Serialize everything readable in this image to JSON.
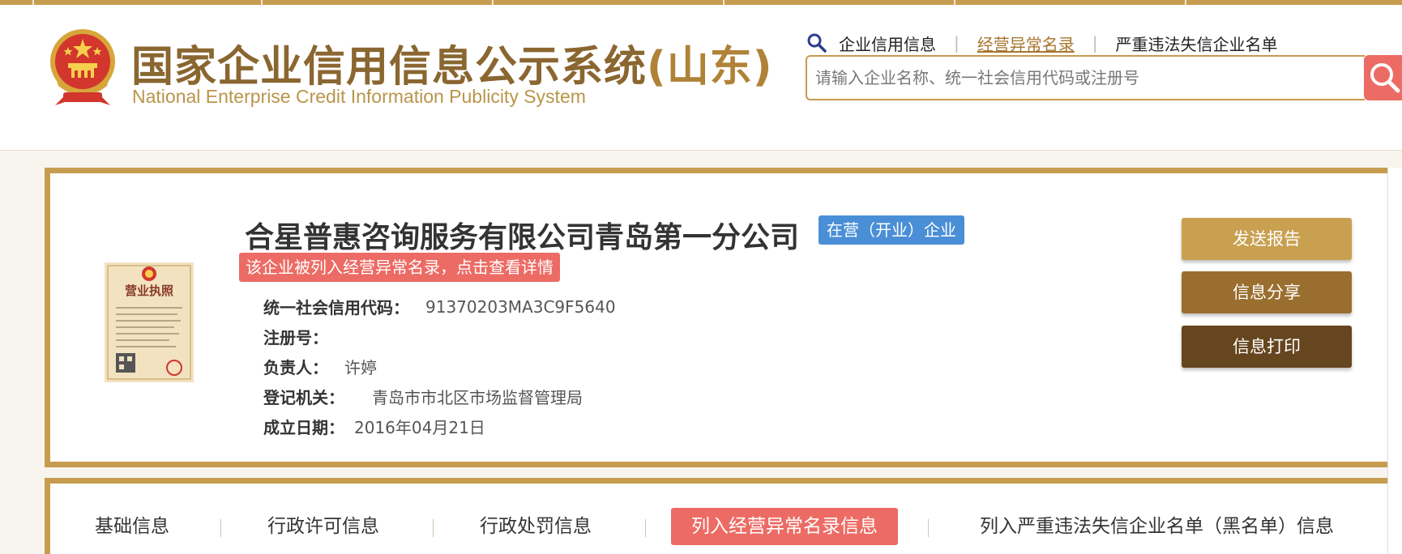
{
  "header": {
    "title_main": "国家企业信用信息公示系统",
    "title_province": "(山东)",
    "subtitle": "National Enterprise Credit Information Publicity System",
    "topnav": [
      {
        "label": "企业信用信息"
      },
      {
        "label": "经营异常名录"
      },
      {
        "label": "严重违法失信企业名单"
      }
    ],
    "search_placeholder": "请输入企业名称、统一社会信用代码或注册号"
  },
  "company": {
    "name": "合星普惠咨询服务有限公司青岛第一分公司",
    "status": "在营（开业）企业",
    "abnormal_notice": "该企业被列入经营异常名录，点击查看详情",
    "fields": [
      {
        "label": "统一社会信用代码：",
        "value": "91370203MA3C9F5640"
      },
      {
        "label": "注册号：",
        "value": ""
      },
      {
        "label": "负责人：",
        "value": "许婷"
      },
      {
        "label": "登记机关：",
        "value": "青岛市市北区市场监督管理局"
      },
      {
        "label": "成立日期：",
        "value": "2016年04月21日"
      }
    ],
    "license_header": "营业执照"
  },
  "actions": {
    "send_report": "发送报告",
    "share": "信息分享",
    "print": "信息打印"
  },
  "tabs": [
    {
      "label": "基础信息"
    },
    {
      "label": "行政许可信息"
    },
    {
      "label": "行政处罚信息"
    },
    {
      "label": "列入经营异常名录信息"
    },
    {
      "label": "列入严重违法失信企业名单（黑名单）信息"
    }
  ],
  "colors": {
    "brand_gold": "#c69c4e",
    "title_brown": "#8a6630",
    "alert_red": "#ec6b64",
    "status_blue": "#4a8fd6",
    "btn_send": "#c9a050",
    "btn_share": "#9a6e2e",
    "btn_print": "#66461f"
  },
  "icons": {
    "search": "search-icon",
    "emblem": "national-emblem-icon",
    "license": "business-license-image"
  }
}
